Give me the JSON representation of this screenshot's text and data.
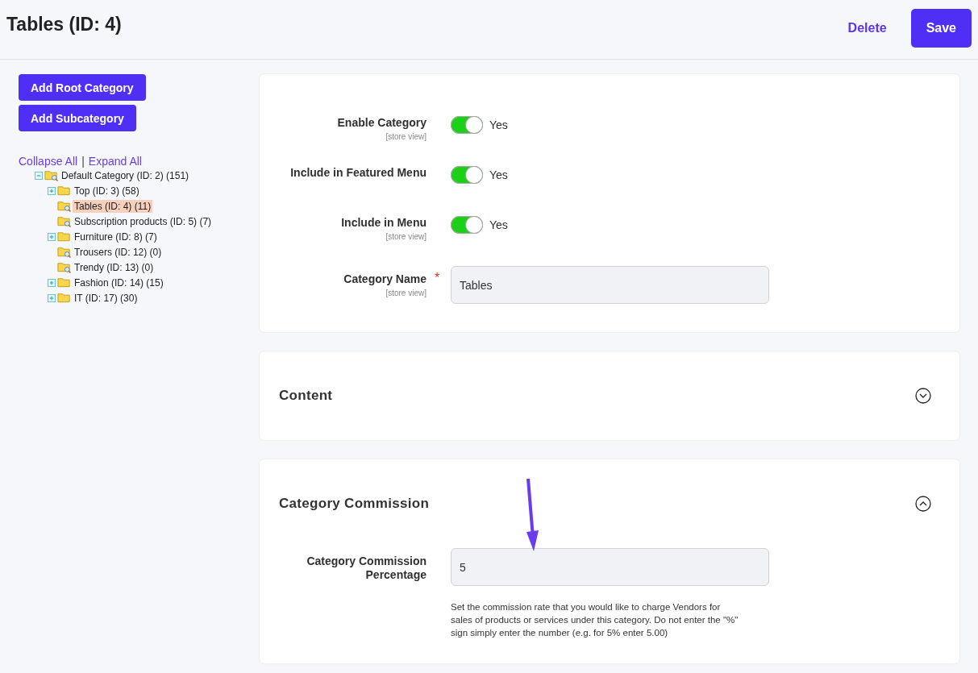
{
  "header": {
    "title": "Tables (ID: 4)",
    "actions": [
      {
        "label": "Delete",
        "kind": "link"
      },
      {
        "label": "Save",
        "kind": "primary"
      }
    ]
  },
  "sidebar": {
    "buttons": [
      "Add Root Category",
      "Add Subcategory"
    ],
    "tree_links": [
      "Collapse All",
      "Expand All"
    ],
    "tree_link_separator": "|",
    "tree": [
      {
        "label": "Default Category (ID: 2) (151)",
        "kind": "search",
        "selected": false,
        "expanded": true,
        "children": [
          {
            "label": "Top (ID: 3) (58)",
            "kind": "folder",
            "selected": false,
            "expanded": false
          },
          {
            "label": "Tables (ID: 4) (11)",
            "kind": "search",
            "selected": true
          },
          {
            "label": "Subscription products (ID: 5) (7)",
            "kind": "search",
            "selected": false
          },
          {
            "label": "Furniture (ID: 8) (7)",
            "kind": "folder",
            "selected": false,
            "expanded": false
          },
          {
            "label": "Trousers (ID: 12) (0)",
            "kind": "search",
            "selected": false
          },
          {
            "label": "Trendy (ID: 13) (0)",
            "kind": "search",
            "selected": false
          },
          {
            "label": "Fashion (ID: 14) (15)",
            "kind": "folder",
            "selected": false,
            "expanded": false
          },
          {
            "label": "IT (ID: 17) (30)",
            "kind": "folder",
            "selected": false,
            "expanded": false
          }
        ]
      }
    ]
  },
  "general": {
    "fields": [
      {
        "kind": "toggle",
        "label": "Enable Category",
        "scope": "[store view]",
        "on": true,
        "value": "Yes"
      },
      {
        "kind": "toggle",
        "label": "Include in Featured Menu",
        "on": true,
        "value": "Yes"
      },
      {
        "kind": "toggle",
        "label": "Include in Menu",
        "scope": "[store view]",
        "on": true,
        "value": "Yes"
      },
      {
        "kind": "text",
        "label": "Category Name",
        "scope": "[store view]",
        "required_mark": "*",
        "value": "Tables"
      }
    ]
  },
  "sections": [
    {
      "title": "Content",
      "expanded": false
    },
    {
      "title": "Category Commission",
      "expanded": true,
      "fields": [
        {
          "kind": "text",
          "label": "Category Commission Percentage",
          "value": "5",
          "note": "Set the commission rate that you would like to charge Vendors for sales of products or services under this category. Do not enter the \"%\" sign simply enter the number (e.g. for 5% enter 5.00)"
        }
      ]
    }
  ]
}
